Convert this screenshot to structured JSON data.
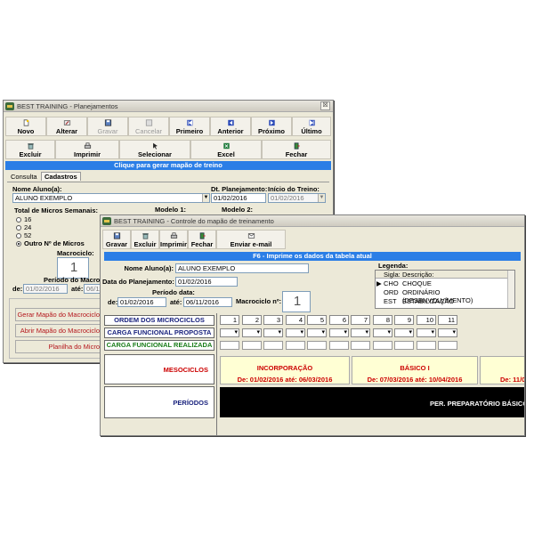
{
  "back": {
    "title": "BEST TRAINING - Planejamentos",
    "close": "☒",
    "toolbar1": [
      {
        "label": "Novo",
        "icon": "new-doc-icon",
        "enabled": true
      },
      {
        "label": "Alterar",
        "icon": "edit-icon",
        "enabled": true
      },
      {
        "label": "Gravar",
        "icon": "save-icon",
        "enabled": false
      },
      {
        "label": "Cancelar",
        "icon": "cancel-icon",
        "enabled": false
      },
      {
        "label": "Primeiro",
        "icon": "first-record-icon",
        "enabled": true
      },
      {
        "label": "Anterior",
        "icon": "previous-record-icon",
        "enabled": true
      },
      {
        "label": "Próximo",
        "icon": "next-record-icon",
        "enabled": true
      },
      {
        "label": "Último",
        "icon": "last-record-icon",
        "enabled": true
      }
    ],
    "toolbar2": [
      {
        "label": "Excluir",
        "icon": "delete-icon"
      },
      {
        "label": "Imprimir",
        "icon": "print-icon"
      },
      {
        "label": "Selecionar",
        "icon": "select-icon"
      },
      {
        "label": "Excel",
        "icon": "excel-icon"
      },
      {
        "label": "Fechar",
        "icon": "exit-icon"
      }
    ],
    "banner": "Clique para gerar mapão de treino",
    "tabs": [
      "Consulta",
      "Cadastros"
    ],
    "nome_label": "Nome Aluno(a):",
    "nome_value": "ALUNO EXEMPLO",
    "dt_plan_label": "Dt. Planejamento:",
    "dt_plan_value": "01/02/2016",
    "inicio_label": "Início do Treino:",
    "inicio_value": "01/02/2016",
    "total_micros_label": "Total de Micros Semanais:",
    "radios": [
      "16",
      "24",
      "52",
      "Outro Nº de Micros"
    ],
    "modelo1": "Modelo 1:",
    "modelo2": "Modelo 2:",
    "macrociclo_label": "Macrociclo:",
    "macrociclo_value": "1",
    "periodo_label": "Período do Macrociclo:",
    "de_label": "de:",
    "de_value": "01/02/2016",
    "ate_label": "até:",
    "ate_value": "06/11/2016",
    "side_buttons": [
      "Gerar Mapão do Macrociclo",
      "Abrir Mapão do Macrociclo",
      "Planilha do Micro"
    ]
  },
  "front": {
    "title": "BEST TRAINING - Controle do mapão de treinamento",
    "toolbar": [
      {
        "label": "Gravar",
        "icon": "save-icon"
      },
      {
        "label": "Excluir",
        "icon": "delete-icon"
      },
      {
        "label": "Imprimir",
        "icon": "print-icon"
      },
      {
        "label": "Fechar",
        "icon": "exit-icon"
      },
      {
        "label": "Enviar e-mail",
        "icon": "email-icon"
      }
    ],
    "banner": "F6 - Imprime os dados da tabela atual",
    "nome_label": "Nome Aluno(a):",
    "nome_value": "ALUNO EXEMPLO",
    "data_plan_label": "Data do Planejamento:",
    "data_plan_value": "01/02/2016",
    "periodo_data_label": "Período data:",
    "de_label": "de:",
    "de_value": "01/02/2016",
    "ate_label": "até:",
    "ate_value": "06/11/2016",
    "macrociclo_label": "Macrociclo nº:",
    "macrociclo_value": "1",
    "legenda": {
      "title": "Legenda:",
      "headers": [
        "Sigla:",
        "Descrição:"
      ],
      "rows": [
        {
          "sigla": "CHO",
          "desc": "CHOQUE"
        },
        {
          "sigla": "ORD",
          "desc": "ORDINÁRIO (DESENVOLVIMENTO)"
        },
        {
          "sigla": "EST",
          "desc": "ESTABILIZAÇÃO"
        }
      ]
    },
    "row_headers": {
      "ordem": "ORDEM DOS MICROCICLOS",
      "proposta": "CARGA FUNCIONAL PROPOSTA",
      "realizada": "CARGA FUNCIONAL REALIZADA",
      "mesociclos": "MESOCICLOS",
      "periodos": "PERÍODOS"
    },
    "micro_numbers": [
      "1",
      "2",
      "3",
      "4",
      "5",
      "6",
      "7",
      "8",
      "9",
      "10",
      "11"
    ],
    "mesos": [
      {
        "name": "INCORPORAÇÃO",
        "dates": "De: 01/02/2016 até: 06/03/2016"
      },
      {
        "name": "BÁSICO I",
        "dates": "De: 07/03/2016 até: 10/04/2016"
      },
      {
        "name": "",
        "dates": "De: 11/04/"
      }
    ],
    "periodo_text": "PER. PREPARATÓRIO BÁSICO"
  }
}
